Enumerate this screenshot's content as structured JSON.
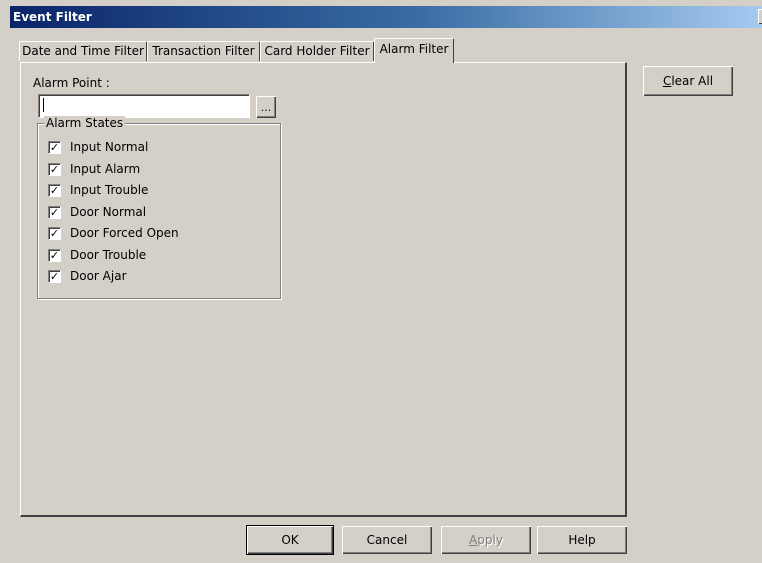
{
  "window": {
    "title": "Event Filter",
    "close_glyph": "×"
  },
  "tabs": [
    {
      "label": "Date and Time Filter",
      "active": false
    },
    {
      "label": "Transaction Filter",
      "active": false
    },
    {
      "label": "Card Holder Filter",
      "active": false
    },
    {
      "label": "Alarm Filter",
      "active": true
    }
  ],
  "alarm_point": {
    "label": "Alarm Point :",
    "value": "",
    "browse_label": "..."
  },
  "alarm_states": {
    "title": "Alarm States",
    "items": [
      {
        "label": "Input Normal",
        "checked": true
      },
      {
        "label": "Input Alarm",
        "checked": true
      },
      {
        "label": "Input Trouble",
        "checked": true
      },
      {
        "label": "Door Normal",
        "checked": true
      },
      {
        "label": "Door Forced Open",
        "checked": true
      },
      {
        "label": "Door Trouble",
        "checked": true
      },
      {
        "label": "Door Ajar",
        "checked": true
      }
    ]
  },
  "side": {
    "clear_all_first": "C",
    "clear_all_rest": "lear All"
  },
  "buttons": {
    "ok": "OK",
    "cancel": "Cancel",
    "apply_first": "A",
    "apply_rest": "pply",
    "help": "Help"
  },
  "check_glyph": "✓"
}
